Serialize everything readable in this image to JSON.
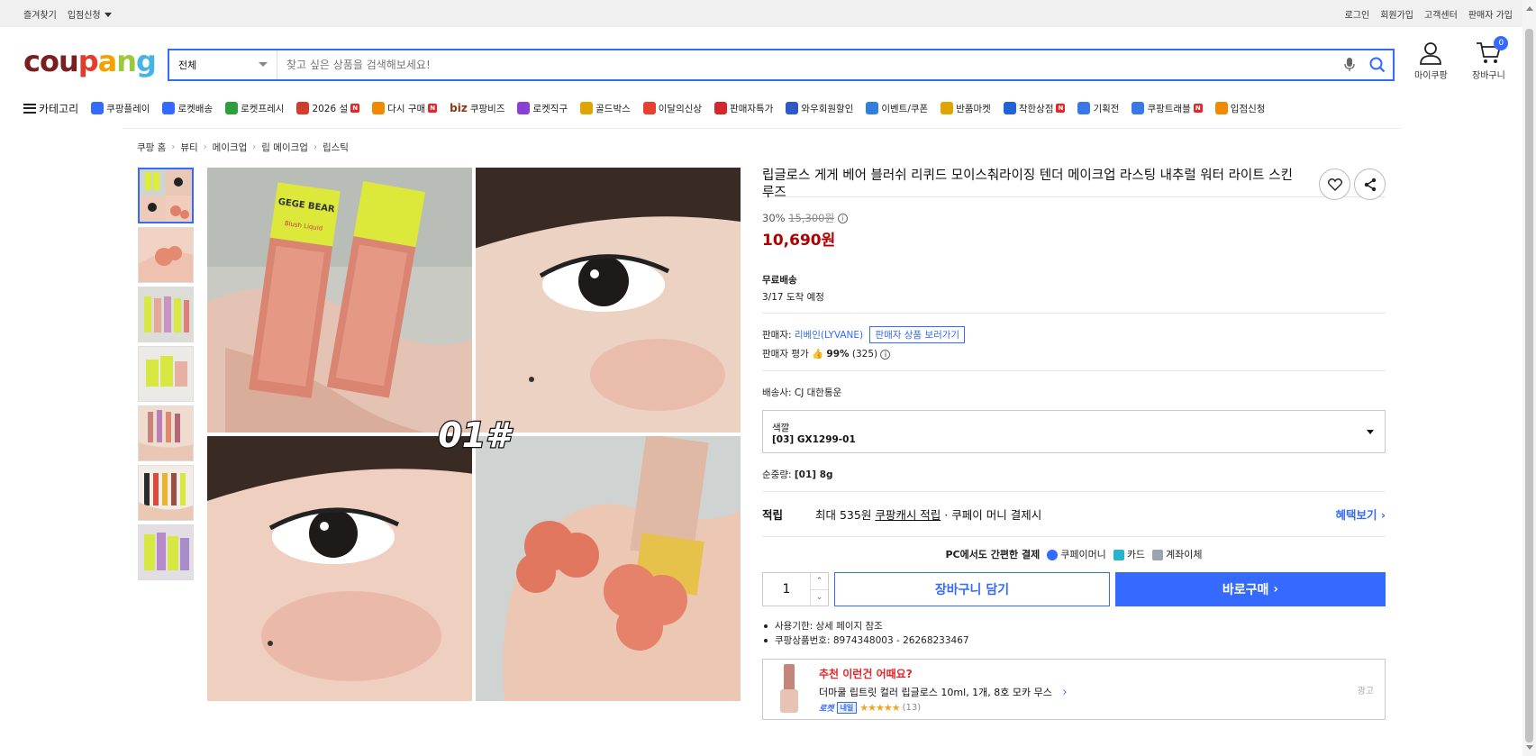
{
  "topbar": {
    "left": [
      "즐겨찾기",
      "입점신청"
    ],
    "right": [
      "로그인",
      "회원가입",
      "고객센터",
      "판매자 가입"
    ]
  },
  "header": {
    "logo_letters": [
      {
        "ch": "c",
        "color": "#7a1f1f"
      },
      {
        "ch": "o",
        "color": "#7a1f1f"
      },
      {
        "ch": "u",
        "color": "#7a1f1f"
      },
      {
        "ch": "p",
        "color": "#e33b2e"
      },
      {
        "ch": "a",
        "color": "#f4a200"
      },
      {
        "ch": "n",
        "color": "#9bc93a"
      },
      {
        "ch": "g",
        "color": "#45b5e0"
      }
    ],
    "search_category": "전체",
    "search_placeholder": "찾고 싶은 상품을 검색해보세요!",
    "mypage_label": "마이쿠팡",
    "cart_label": "장바구니",
    "cart_count": "0"
  },
  "nav": {
    "category_label": "카테고리",
    "items": [
      {
        "label": "쿠팡플레이",
        "color": "#346aff",
        "badge": ""
      },
      {
        "label": "로켓배송",
        "color": "#346aff",
        "badge": ""
      },
      {
        "label": "로켓프레시",
        "color": "#2e9e3a",
        "badge": ""
      },
      {
        "label": "2026 설",
        "color": "#d33b2c",
        "badge": "N"
      },
      {
        "label": "다시 구매",
        "color": "#f08a00",
        "badge": "N"
      },
      {
        "label": "쿠팡비즈",
        "color": "#8a3a0f",
        "badge": "",
        "prefix": "biz"
      },
      {
        "label": "로켓직구",
        "color": "#8b3fd6",
        "badge": ""
      },
      {
        "label": "골드박스",
        "color": "#e0a400",
        "badge": ""
      },
      {
        "label": "이달의신상",
        "color": "#e6412f",
        "badge": ""
      },
      {
        "label": "판매자특가",
        "color": "#d4262b",
        "badge": ""
      },
      {
        "label": "와우회원할인",
        "color": "#2f57c8",
        "badge": ""
      },
      {
        "label": "이벤트/쿠폰",
        "color": "#2f7ee0",
        "badge": ""
      },
      {
        "label": "반품마켓",
        "color": "#e0a400",
        "badge": ""
      },
      {
        "label": "착한상점",
        "color": "#1f63d6",
        "badge": "N"
      },
      {
        "label": "기획전",
        "color": "#3b78e7",
        "badge": ""
      },
      {
        "label": "쿠팡트래블",
        "color": "#3b78e7",
        "badge": "N"
      },
      {
        "label": "입점신청",
        "color": "#f08a00",
        "badge": ""
      }
    ]
  },
  "breadcrumb": [
    "쿠팡 홈",
    "뷰티",
    "메이크업",
    "립 메이크업",
    "립스틱"
  ],
  "image": {
    "overlay_text": "01#",
    "box_text_1": "GEGE BEAR",
    "box_text_2": "Blush Liquid"
  },
  "product": {
    "title": "립글로스 게게 베어 블러쉬 리퀴드 모이스춰라이징 텐더 메이크업 라스팅 내추럴 워터 라이트 스킨 루즈",
    "discount_rate": "30%",
    "original_price": "15,300원",
    "price": "10,690원",
    "shipping_label": "무료배송",
    "arrival": "3/17 도착 예정",
    "seller_label": "판매자:",
    "seller_name": "리베인(LYVANE)",
    "seller_button": "판매자 상품 보러가기",
    "seller_rating_label": "판매자 평가",
    "seller_rating": "99%",
    "seller_reviews": "(325)",
    "courier_label": "배송사:",
    "courier": "CJ 대한통운",
    "option_label": "색깔",
    "option_value": "[03] GX1299-01",
    "net_label": "순중량:",
    "net_value": "[01] 8g",
    "reward_label": "적립",
    "reward_text1": "최대 535원",
    "reward_link": "쿠팡캐시 적립",
    "reward_text2": "· 쿠페이 머니 결제시",
    "reward_more": "혜택보기",
    "pay_title": "PC에서도 간편한 결제",
    "pay_methods": [
      {
        "label": "쿠페이머니",
        "color": "#346aff"
      },
      {
        "label": "카드",
        "color": "#29b3c9"
      },
      {
        "label": "계좌이체",
        "color": "#9aa4b3"
      }
    ],
    "quantity": "1",
    "cart_button": "장바구니 담기",
    "buy_button": "바로구매",
    "bullets": [
      "사용기한: 상세 페이지 참조",
      "쿠팡상품번호: 8974348003 - 26268233467"
    ]
  },
  "ad": {
    "title_red": "추천",
    "title_rest": " 이런건 어때요?",
    "product": "더마쿨 립트릿 컬러 립글로스 10ml, 1개, 8호 모카 무스",
    "rocket": "로켓",
    "rocket_tag": "내일",
    "stars": "★★★★★",
    "rating_value": 5,
    "reviews": "(13)",
    "ad_label": "광고"
  }
}
